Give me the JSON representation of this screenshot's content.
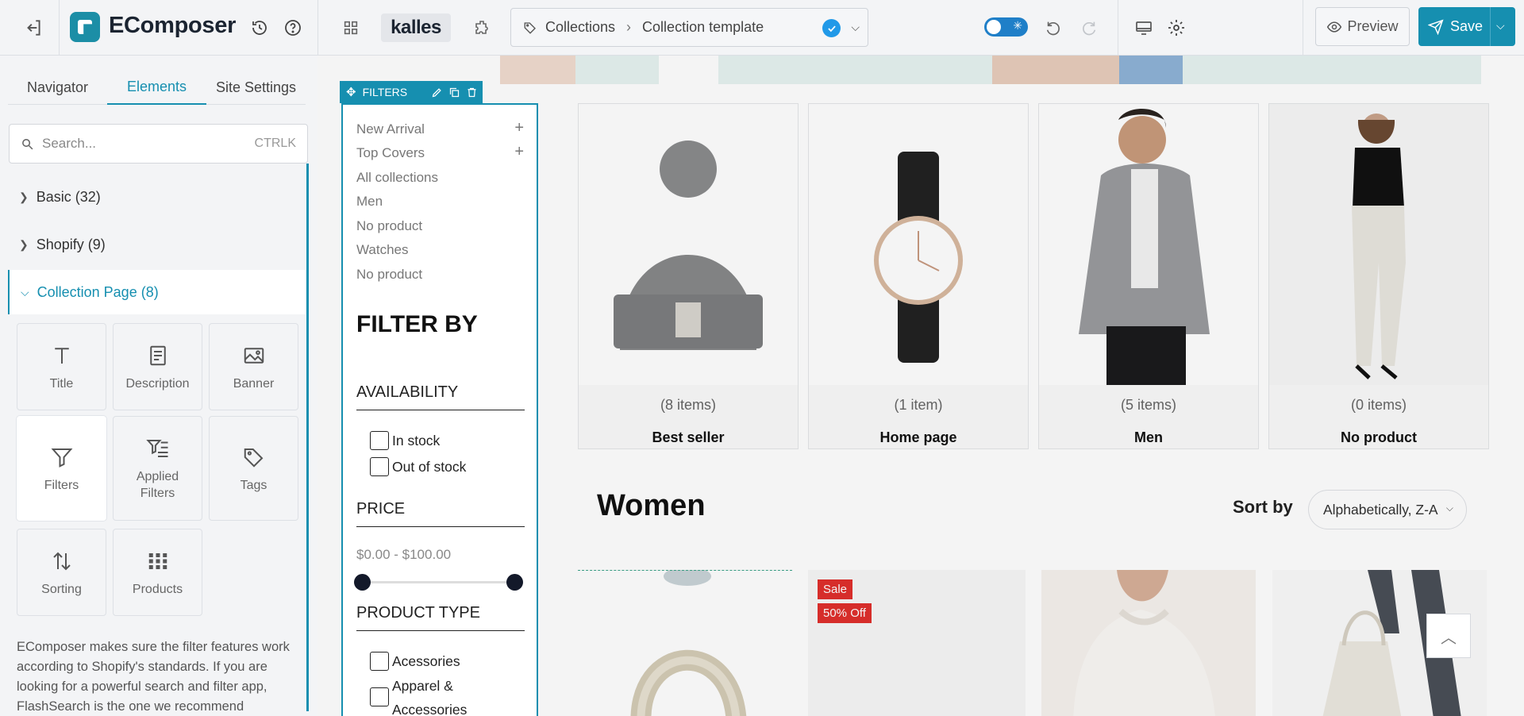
{
  "app": {
    "name": "EComposer",
    "theme": "kalles"
  },
  "breadcrumb": {
    "root": "Collections",
    "current": "Collection template"
  },
  "toolbar": {
    "preview_label": "Preview",
    "save_label": "Save"
  },
  "left_tabs": [
    "Navigator",
    "Elements",
    "Site Settings"
  ],
  "search": {
    "placeholder": "Search...",
    "shortcut": "CTRLK"
  },
  "categories": [
    {
      "label": "Basic (32)",
      "open": false
    },
    {
      "label": "Shopify (9)",
      "open": false
    },
    {
      "label": "Collection Page (8)",
      "open": true
    }
  ],
  "elements": [
    {
      "label": "Title",
      "icon": "title-icon"
    },
    {
      "label": "Description",
      "icon": "description-icon"
    },
    {
      "label": "Banner",
      "icon": "banner-icon"
    },
    {
      "label": "Filters",
      "icon": "filter-icon",
      "selected": true
    },
    {
      "label": "Applied Filters",
      "icon": "applied-filters-icon"
    },
    {
      "label": "Tags",
      "icon": "tag-icon"
    },
    {
      "label": "Sorting",
      "icon": "sorting-icon"
    },
    {
      "label": "Products",
      "icon": "products-grid-icon"
    }
  ],
  "description": "EComposer makes sure the filter features work according to Shopify's standards. If you are looking for a powerful search and filter app, FlashSearch is the one we recommend",
  "filter_widget": {
    "tag_label": "FILTERS",
    "collections": [
      "New Arrival",
      "Top Covers",
      "All collections",
      "Men",
      "No product",
      "Watches",
      "No product"
    ],
    "title": "FILTER BY",
    "availability": {
      "heading": "AVAILABILITY",
      "options": [
        "In stock",
        "Out of stock"
      ]
    },
    "price": {
      "heading": "PRICE",
      "range_text": "$0.00 - $100.00",
      "min": 0,
      "max": 100
    },
    "product_type": {
      "heading": "PRODUCT TYPE",
      "options": [
        "Acessories",
        "Apparel & Accessories"
      ]
    }
  },
  "collection_cards": [
    {
      "count": "(8 items)",
      "name": "Best seller",
      "image": "beanie-hat"
    },
    {
      "count": "(1 item)",
      "name": "Home page",
      "image": "wrist-watch"
    },
    {
      "count": "(5 items)",
      "name": "Men",
      "image": "man-hoodie"
    },
    {
      "count": "(0 items)",
      "name": "No product",
      "image": "woman-jeans"
    }
  ],
  "section": {
    "title": "Women",
    "sort_label": "Sort by",
    "sort_value": "Alphabetically, Z-A"
  },
  "products": [
    {
      "image": "headphones"
    },
    {
      "image": "sale-item",
      "badges": [
        "Sale",
        "50% Off"
      ]
    },
    {
      "image": "white-sweater"
    },
    {
      "image": "tote-bag"
    }
  ],
  "colors": {
    "accent": "#168fb0",
    "sale": "#e0302c",
    "knob": "#13192a"
  }
}
